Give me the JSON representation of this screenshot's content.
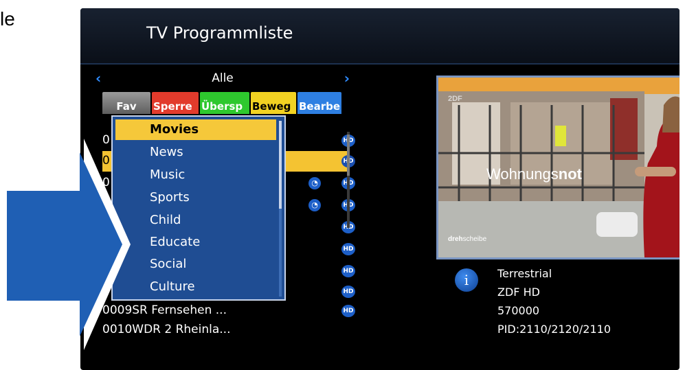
{
  "slide": {
    "text_fragment": "le"
  },
  "header": {
    "title": "TV Programmliste"
  },
  "group_nav": {
    "name": "Alle",
    "prev_icon": "chevron-left-icon",
    "next_icon": "chevron-right-icon"
  },
  "tabs": [
    {
      "label": "Fav",
      "color": "#7a7a7a"
    },
    {
      "label": "Sperre",
      "color": "#e23b2c"
    },
    {
      "label": "Übersp",
      "color": "#2ec82e"
    },
    {
      "label": "Beweg",
      "color": "#f2d222"
    },
    {
      "label": "Bearbe",
      "color": "#2e7fe2"
    }
  ],
  "channels": [
    {
      "text": "0"
    },
    {
      "text": "0"
    },
    {
      "text": "0"
    },
    {
      "text": ""
    },
    {
      "text": ""
    },
    {
      "text": ""
    },
    {
      "text": ""
    },
    {
      "text": ""
    },
    {
      "text": "0009SR Fernsehen ..."
    },
    {
      "text": "0010WDR 2 Rheinla..."
    }
  ],
  "badge_labels": {
    "hd": "HD",
    "sat": "◔"
  },
  "dropdown": {
    "items": [
      "Movies",
      "News",
      "Music",
      "Sports",
      "Child",
      "Educate",
      "Social",
      "Culture"
    ],
    "selected_index": 0
  },
  "preview": {
    "headline_normal": "Wohnungs",
    "headline_bold": "not",
    "program_logo_normal": "dreh",
    "program_logo_bold": "scheibe",
    "channel_logo": "2DF"
  },
  "info": {
    "icon": "info-icon",
    "icon_glyph": "i",
    "source": "Terrestrial",
    "channel": "ZDF HD",
    "frequency": "570000",
    "pid": "PID:2110/2120/2110"
  },
  "colors": {
    "accent_selection": "#f4c332",
    "dropdown_bg": "#1f4d93",
    "callout_arrow": "#1f5fb4"
  }
}
